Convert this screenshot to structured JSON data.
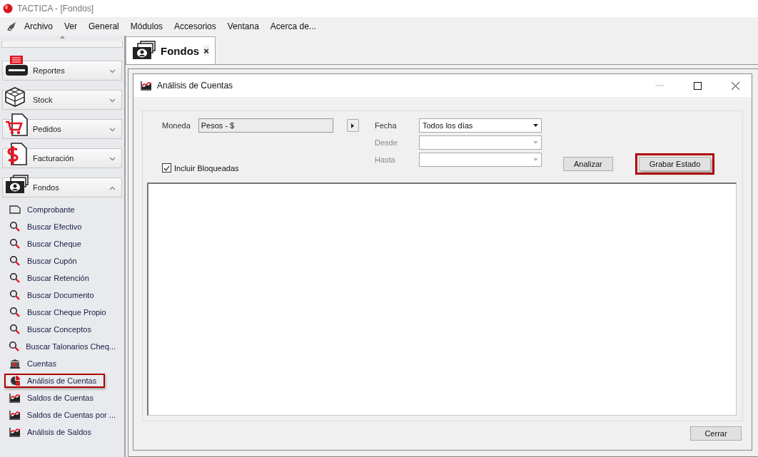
{
  "window": {
    "title": "TACTICA - [Fondos]"
  },
  "menu": [
    "Archivo",
    "Ver",
    "General",
    "Módulos",
    "Accesorios",
    "Ventana",
    "Acerca de..."
  ],
  "sidebar": {
    "groups": [
      {
        "label": "Reportes",
        "kind": "printer",
        "expanded": false
      },
      {
        "label": "Stock",
        "kind": "cube",
        "expanded": false
      },
      {
        "label": "Pedidos",
        "kind": "cart",
        "expanded": false
      },
      {
        "label": "Facturación",
        "kind": "dollar",
        "expanded": false
      },
      {
        "label": "Fondos",
        "kind": "money",
        "expanded": true
      }
    ],
    "items": [
      {
        "label": "Comprobante",
        "kind": "document",
        "highlighted": false
      },
      {
        "label": "Buscar Efectivo",
        "kind": "search",
        "highlighted": false
      },
      {
        "label": "Buscar Cheque",
        "kind": "search",
        "highlighted": false
      },
      {
        "label": "Buscar Cupón",
        "kind": "search",
        "highlighted": false
      },
      {
        "label": "Buscar Retención",
        "kind": "search",
        "highlighted": false
      },
      {
        "label": "Buscar Documento",
        "kind": "search",
        "highlighted": false
      },
      {
        "label": "Buscar Cheque Propio",
        "kind": "search",
        "highlighted": false
      },
      {
        "label": "Buscar Conceptos",
        "kind": "search",
        "highlighted": false
      },
      {
        "label": "Buscar Talonarios Cheq...",
        "kind": "search",
        "highlighted": false
      },
      {
        "label": "Cuentas",
        "kind": "bank",
        "highlighted": false
      },
      {
        "label": "Análisis de Cuentas",
        "kind": "pie",
        "highlighted": true
      },
      {
        "label": "Saldos de Cuentas",
        "kind": "chart",
        "highlighted": false
      },
      {
        "label": "Saldos de Cuentas por ...",
        "kind": "chart",
        "highlighted": false
      },
      {
        "label": "Análisis de Saldos",
        "kind": "chart",
        "highlighted": false
      }
    ]
  },
  "tabs": [
    {
      "label": "Fondos",
      "selected": true,
      "close": "×"
    }
  ],
  "dialog": {
    "title": "Análisis de Cuentas",
    "moneda": {
      "label": "Moneda",
      "value": "Pesos - $"
    },
    "fecha": {
      "label": "Fecha",
      "value": "Todos los días",
      "disabled": false
    },
    "desde": {
      "label": "Desde",
      "disabled": true
    },
    "hasta": {
      "label": "Hasta",
      "disabled": true
    },
    "incluir": {
      "label": "Incluir Bloqueadas",
      "checked": true
    },
    "buttons": [
      {
        "label": "Analizar",
        "highlighted": false
      },
      {
        "label": "Grabar Estado",
        "highlighted": true
      }
    ],
    "close_button": "Cerrar"
  }
}
